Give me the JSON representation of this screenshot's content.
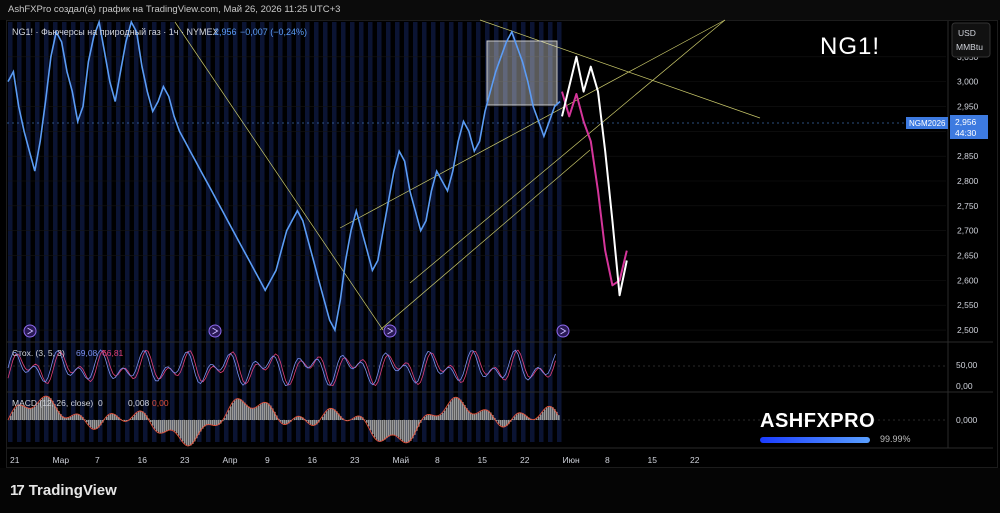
{
  "header": {
    "caption": "AshFXPro создал(а) график на TradingView.com, Май 26, 2026 11:25 UTC+3"
  },
  "overlay_title": "NG1!",
  "legend": {
    "symbol": "NG1! · Фьючерсы на природный газ · 1ч · NYMEX",
    "price": "2,956",
    "change": "−0,007 (−0,24%)"
  },
  "currency": {
    "line1": "USD",
    "line2": "MMBtu"
  },
  "price_tag": {
    "contract": "NGM2026",
    "value": "2,956",
    "countdown": "44:30"
  },
  "stoch": {
    "label": "Стох. (3, 5, 3)",
    "k": "69,08",
    "d": "66,81"
  },
  "macd": {
    "label": "MACD (12, 26, close)",
    "a": "0",
    "b": "0,008",
    "c": "0,00"
  },
  "pane_ticks": {
    "stoch": [
      "50,00",
      "0,00"
    ],
    "macd": [
      "0,000"
    ]
  },
  "brand": {
    "name": "ASHFXPRO",
    "percent": "99.99%"
  },
  "footer": {
    "logo_text": "TradingView"
  },
  "colors": {
    "price": "#5b9cf5",
    "trend": "#c9c86a",
    "magenta": "#d4359a",
    "white": "#ffffff",
    "stoch_k": "#7a8ff0",
    "stoch_d": "#e0407a",
    "macd_line": "#e0503a"
  },
  "chart_data": {
    "type": "line",
    "y_axis": {
      "ticks": [
        "3,050",
        "3,000",
        "2,950",
        "2,900",
        "2,850",
        "2,800",
        "2,750",
        "2,700",
        "2,650",
        "2,600",
        "2,550",
        "2,500"
      ],
      "range": [
        2.48,
        3.12
      ]
    },
    "x_axis": {
      "ticks": [
        "21",
        "Мар",
        "7",
        "16",
        "23",
        "Апр",
        "9",
        "16",
        "23",
        "Май",
        "8",
        "15",
        "22",
        "Июн",
        "8",
        "15",
        "22"
      ]
    },
    "series": [
      {
        "values": [
          3.0,
          3.02,
          2.95,
          2.9,
          2.86,
          2.82,
          2.88,
          2.96,
          3.05,
          3.1,
          3.08,
          3.02,
          2.98,
          2.92,
          2.95,
          3.04,
          3.09,
          3.12,
          3.06,
          3.0,
          2.96,
          3.02,
          3.08,
          3.12,
          3.1,
          3.03,
          2.98,
          2.94,
          2.96,
          2.99,
          2.97,
          2.93,
          2.9,
          2.88,
          2.86,
          2.84,
          2.82,
          2.8,
          2.78,
          2.76,
          2.74,
          2.72,
          2.7,
          2.68,
          2.66,
          2.64,
          2.62,
          2.6,
          2.58,
          2.6,
          2.62,
          2.66,
          2.7,
          2.72,
          2.74,
          2.72,
          2.68,
          2.64,
          2.6,
          2.56,
          2.52,
          2.5,
          2.56,
          2.64,
          2.7,
          2.74,
          2.7,
          2.66,
          2.62,
          2.64,
          2.7,
          2.76,
          2.82,
          2.86,
          2.84,
          2.78,
          2.74,
          2.7,
          2.72,
          2.78,
          2.82,
          2.8,
          2.78,
          2.82,
          2.88,
          2.92,
          2.9,
          2.86,
          2.88,
          2.94,
          2.98,
          3.02,
          3.05,
          3.08,
          3.1,
          3.07,
          3.04,
          3.0,
          2.95,
          2.92,
          2.89,
          2.92,
          2.95,
          2.96
        ]
      }
    ],
    "projections": [
      {
        "name": "magenta",
        "points": [
          [
            0,
            2.98
          ],
          [
            1,
            2.93
          ],
          [
            2,
            2.975
          ],
          [
            3,
            2.92
          ],
          [
            4,
            2.88
          ],
          [
            5,
            2.78
          ],
          [
            6,
            2.66
          ],
          [
            7,
            2.59
          ],
          [
            8,
            2.6
          ],
          [
            9,
            2.66
          ]
        ]
      },
      {
        "name": "white",
        "points": [
          [
            0,
            2.93
          ],
          [
            1,
            2.99
          ],
          [
            2,
            3.05
          ],
          [
            3,
            2.98
          ],
          [
            4,
            3.03
          ],
          [
            5,
            2.98
          ],
          [
            6,
            2.86
          ],
          [
            7,
            2.72
          ],
          [
            8,
            2.57
          ],
          [
            9,
            2.64
          ]
        ]
      }
    ]
  }
}
